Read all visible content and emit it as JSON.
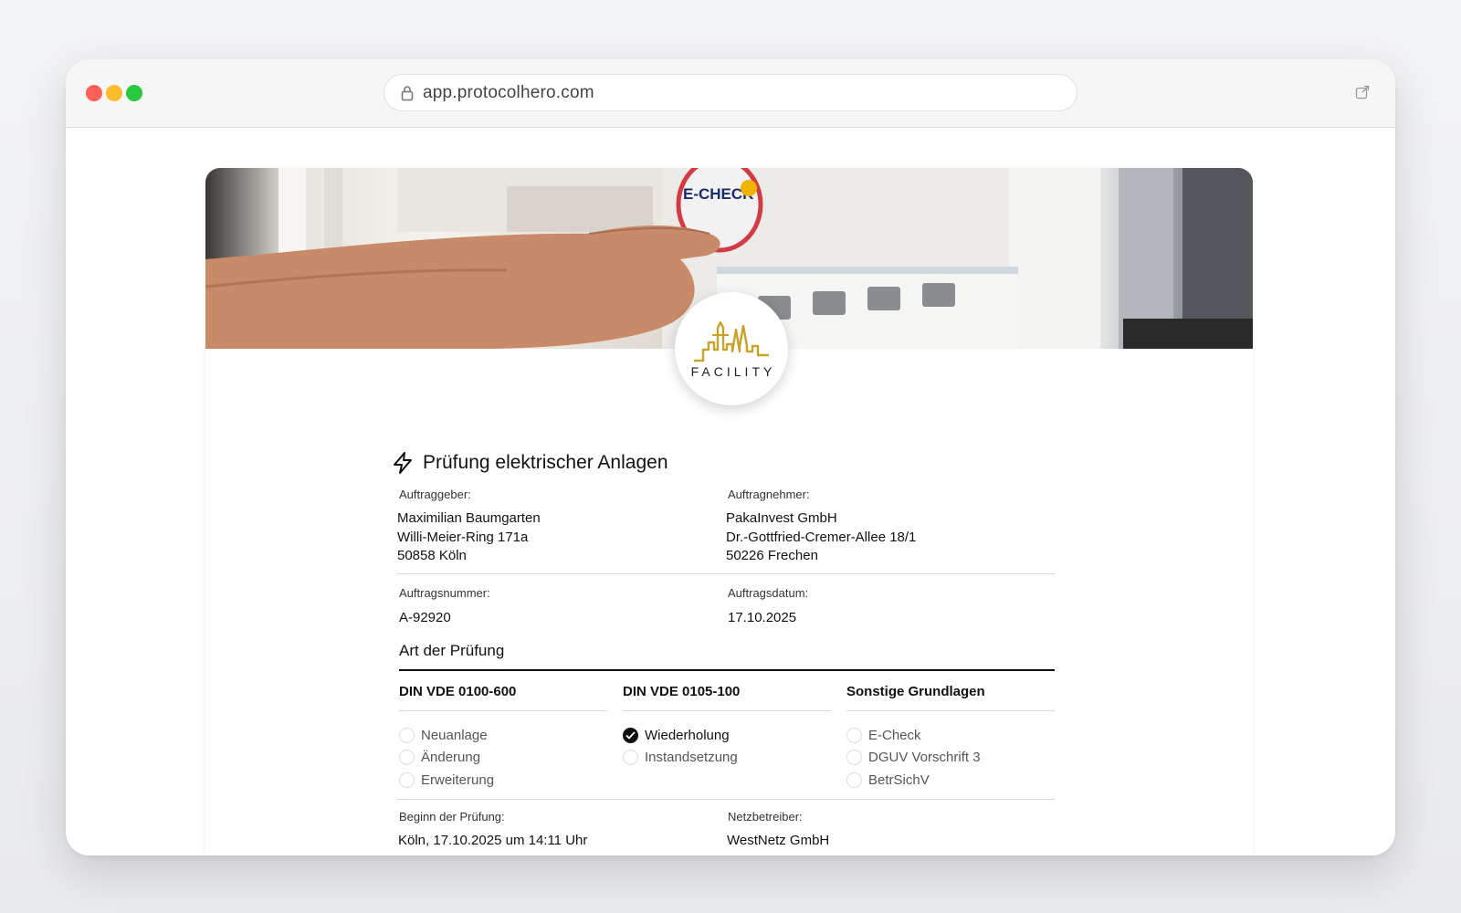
{
  "browser": {
    "url": "app.protocolhero.com"
  },
  "logo": {
    "word": "FACILITY",
    "accent_color": "#c9a227"
  },
  "hero": {
    "sticker_text": "E-CHECK"
  },
  "form": {
    "title": "Prüfung elektrischer Anlagen",
    "auftraggeber": {
      "label": "Auftraggeber:",
      "lines": [
        "Maximilian Baumgarten",
        "Willi-Meier-Ring 171a",
        "50858 Köln"
      ]
    },
    "auftragnehmer": {
      "label": "Auftragnehmer:",
      "lines": [
        "PakaInvest GmbH",
        "Dr.-Gottfried-Cremer-Allee 18/1",
        "50226 Frechen"
      ]
    },
    "auftragsnummer": {
      "label": "Auftragsnummer:",
      "value": "A-92920"
    },
    "auftragsdatum": {
      "label": "Auftragsdatum:",
      "value": "17.10.2025"
    },
    "art": {
      "title": "Art der Prüfung",
      "columns": [
        {
          "heading": "DIN VDE 0100-600",
          "options": [
            {
              "label": "Neuanlage",
              "checked": false
            },
            {
              "label": "Änderung",
              "checked": false
            },
            {
              "label": "Erweiterung",
              "checked": false
            }
          ]
        },
        {
          "heading": "DIN VDE 0105-100",
          "options": [
            {
              "label": "Wiederholung",
              "checked": true
            },
            {
              "label": "Instandsetzung",
              "checked": false
            }
          ]
        },
        {
          "heading": "Sonstige Grundlagen",
          "options": [
            {
              "label": "E-Check",
              "checked": false
            },
            {
              "label": "DGUV Vorschrift 3",
              "checked": false
            },
            {
              "label": "BetrSichV",
              "checked": false
            }
          ]
        }
      ]
    },
    "beginn": {
      "label": "Beginn der Prüfung:",
      "value": "Köln, 17.10.2025 um 14:11 Uhr"
    },
    "netzbetreiber": {
      "label": "Netzbetreiber:",
      "value": "WestNetz GmbH"
    }
  }
}
